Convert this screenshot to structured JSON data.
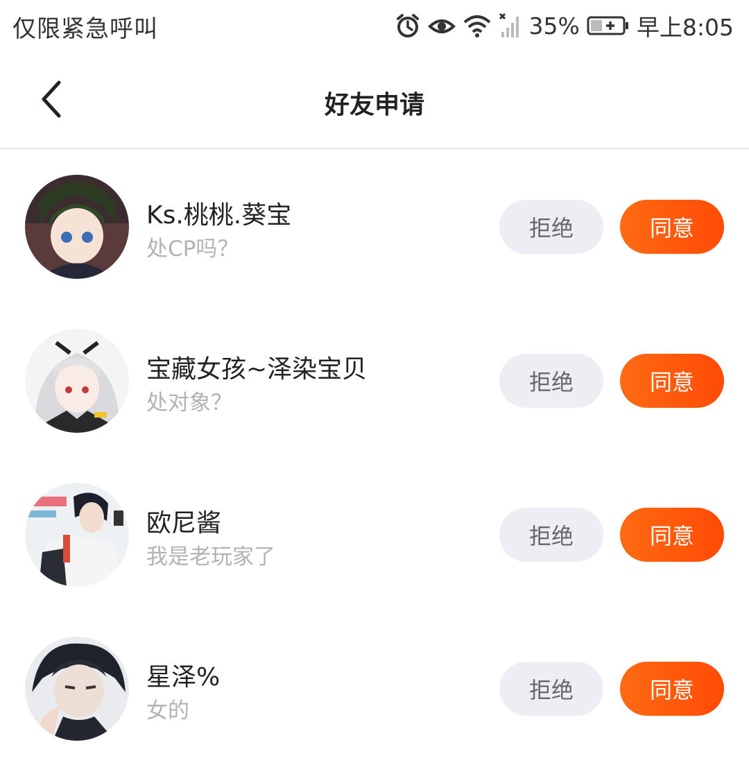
{
  "status_bar": {
    "carrier": "仅限紧急呼叫",
    "battery_percent": "35%",
    "time": "早上8:05",
    "icons": [
      "alarm-icon",
      "eye-icon",
      "wifi-icon",
      "signal-icon",
      "battery-icon"
    ]
  },
  "header": {
    "title": "好友申请",
    "back_icon": "chevron-left-icon"
  },
  "requests": [
    {
      "name": "Ks.桃桃.葵宝",
      "message": "处CP吗？",
      "reject_label": "拒绝",
      "accept_label": "同意"
    },
    {
      "name": "宝藏女孩~泽染宝贝",
      "message": "处对象？",
      "reject_label": "拒绝",
      "accept_label": "同意"
    },
    {
      "name": "欧尼酱",
      "message": "我是老玩家了",
      "reject_label": "拒绝",
      "accept_label": "同意"
    },
    {
      "name": "星泽%",
      "message": "女的",
      "reject_label": "拒绝",
      "accept_label": "同意"
    }
  ],
  "colors": {
    "accent": "#ff5a0a",
    "reject_bg": "#eceef3",
    "muted_text": "#b3b3b3"
  }
}
